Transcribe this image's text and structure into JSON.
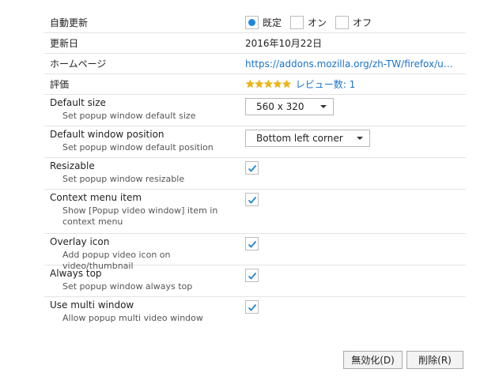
{
  "rows": {
    "auto_update": {
      "label": "自動更新",
      "options": [
        "既定",
        "オン",
        "オフ"
      ],
      "selected": "既定"
    },
    "updated": {
      "label": "更新日",
      "value": "2016年10月22日"
    },
    "homepage": {
      "label": "ホームページ",
      "value": "https://addons.mozilla.org/zh-TW/firefox/use..."
    },
    "rating": {
      "label": "評価",
      "stars": "★★★★★",
      "reviews": "レビュー数: 1"
    }
  },
  "settings": {
    "default_size": {
      "label": "Default size",
      "desc": "Set popup window default size",
      "value": "560 x 320"
    },
    "default_position": {
      "label": "Default window position",
      "desc": "Set popup window default position",
      "value": "Bottom left corner"
    },
    "resizable": {
      "label": "Resizable",
      "desc": "Set popup window resizable",
      "checked": true
    },
    "context_menu": {
      "label": "Context menu item",
      "desc": "Show [Popup video window] item in context menu",
      "checked": true
    },
    "overlay_icon": {
      "label": "Overlay icon",
      "desc": "Add popup video icon on video/thumbnail",
      "checked": true
    },
    "always_top": {
      "label": "Always top",
      "desc": "Set popup window always top",
      "checked": true
    },
    "multi_window": {
      "label": "Use multi window",
      "desc": "Allow popup multi video window",
      "checked": true
    }
  },
  "buttons": {
    "disable": "無効化(D)",
    "remove": "削除(R)"
  },
  "colors": {
    "accent": "#1e88d6",
    "link": "#1a73c9",
    "star": "#f1b400"
  }
}
